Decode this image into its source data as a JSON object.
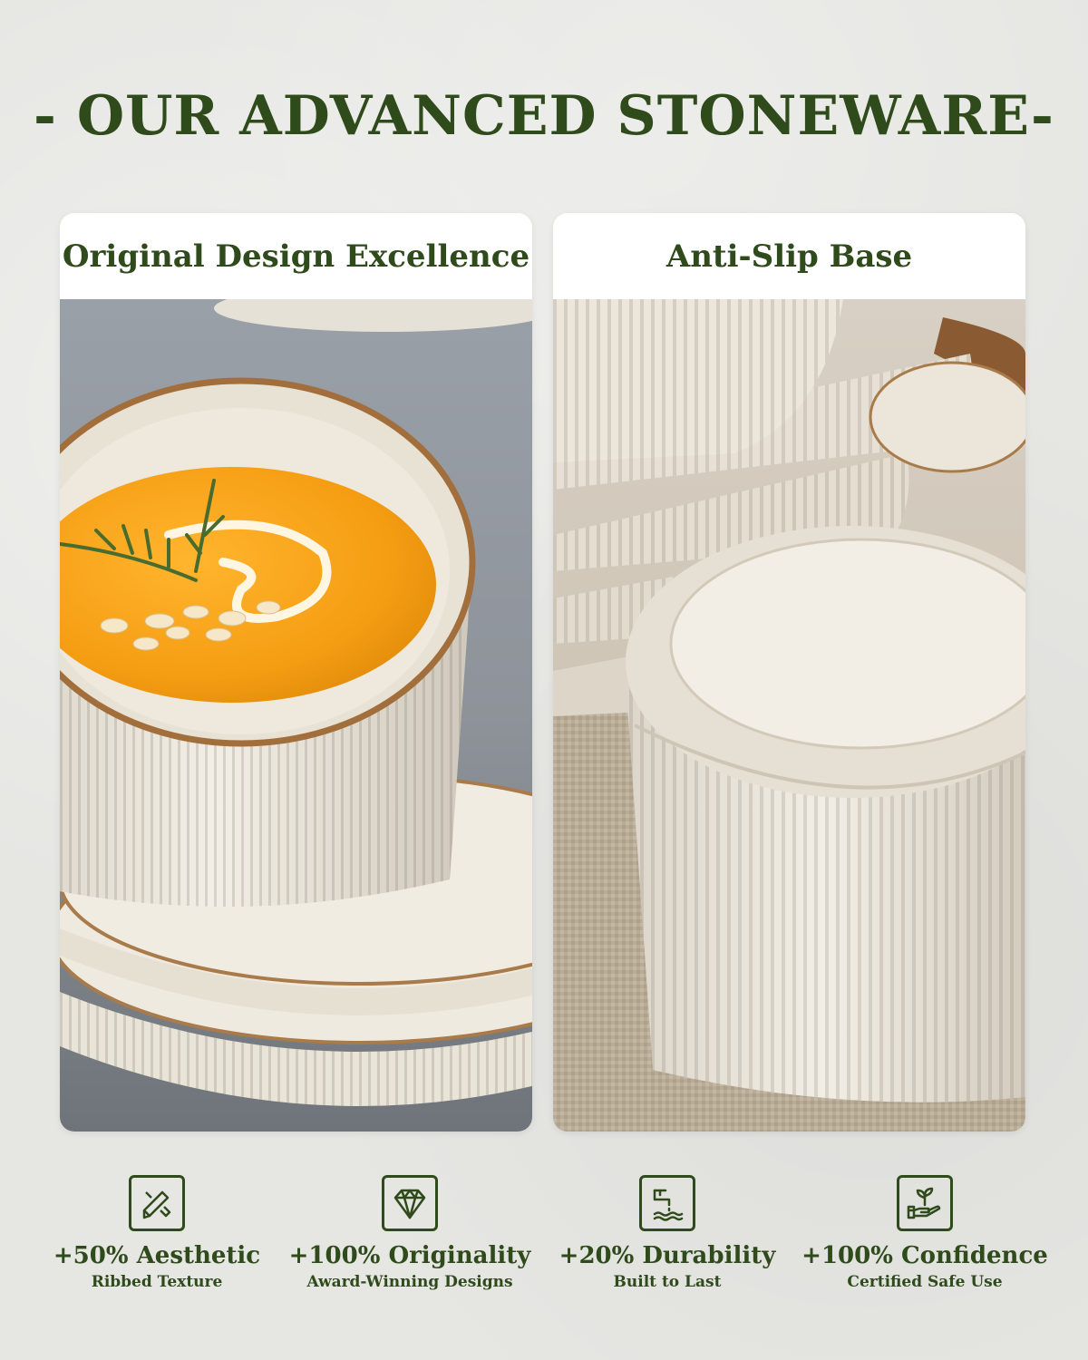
{
  "headline": "- OUR ADVANCED STONEWARE-",
  "cards": [
    {
      "title": "Original Design Excellence",
      "image": "soup-bowl-on-ribbed-plates"
    },
    {
      "title": "Anti-Slip Base",
      "image": "upturned-bowl-with-stacked-plates"
    }
  ],
  "features": [
    {
      "icon": "pencil-ruler-icon",
      "title": "+50% Aesthetic",
      "subtitle": "Ribbed Texture"
    },
    {
      "icon": "diamond-icon",
      "title": "+100% Originality",
      "subtitle": "Award-Winning Designs"
    },
    {
      "icon": "faucet-water-icon",
      "title": "+20% Durability",
      "subtitle": "Built to Last"
    },
    {
      "icon": "hand-sprout-icon",
      "title": "+100% Confidence",
      "subtitle": "Certified Safe Use"
    }
  ],
  "colors": {
    "brand_green": "#2f4a1b",
    "glaze_cream": "#efe9dd",
    "rim_brown": "#a97b4a"
  }
}
